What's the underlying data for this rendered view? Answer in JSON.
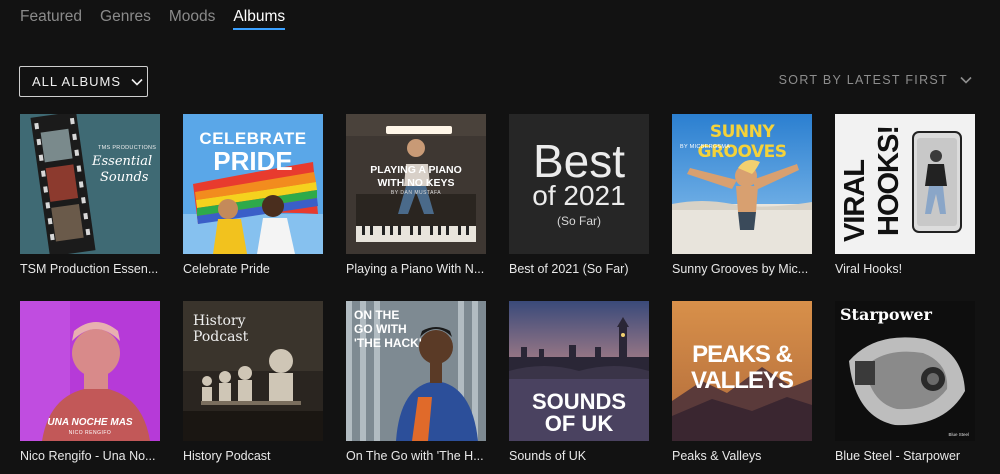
{
  "tabs": [
    {
      "label": "Featured",
      "active": false
    },
    {
      "label": "Genres",
      "active": false
    },
    {
      "label": "Moods",
      "active": false
    },
    {
      "label": "Albums",
      "active": true
    }
  ],
  "filter": {
    "label": "ALL ALBUMS"
  },
  "sort": {
    "label": "SORT BY LATEST FIRST"
  },
  "colors": {
    "background": "#121212",
    "active_tab_underline": "#3aa0ff"
  },
  "albums": [
    {
      "title": "TSM Production Essen...",
      "cover_text": [
        "TMS PRODUCTIONS",
        "Essential",
        "Sounds"
      ]
    },
    {
      "title": "Celebrate Pride",
      "cover_text": [
        "CELEBRATE",
        "PRIDE"
      ]
    },
    {
      "title": "Playing a Piano With N...",
      "cover_text": [
        "PLAYING A PIANO",
        "WITH NO KEYS",
        "BY DAN MUSTAFA"
      ]
    },
    {
      "title": "Best of 2021 (So Far)",
      "cover_text": [
        "Best",
        "of 2021",
        "(So Far)"
      ]
    },
    {
      "title": "Sunny Grooves by Mic...",
      "cover_text": [
        "SUNNY GROOVES",
        "BY MICBERGSMA"
      ]
    },
    {
      "title": "Viral Hooks!",
      "cover_text": [
        "VIRAL",
        "HOOKS!"
      ]
    },
    {
      "title": "Nico Rengifo - Una No...",
      "cover_text": [
        "UNA NOCHE MAS",
        "NICO RENGIFO"
      ]
    },
    {
      "title": "History Podcast",
      "cover_text": [
        "History",
        "Podcast"
      ]
    },
    {
      "title": "On The Go with 'The H...",
      "cover_text": [
        "ON THE",
        "GO WITH",
        "'THE HACK'"
      ]
    },
    {
      "title": "Sounds of UK",
      "cover_text": [
        "SOUNDS",
        "OF UK"
      ]
    },
    {
      "title": "Peaks & Valleys",
      "cover_text": [
        "PEAKS &",
        "VALLEYS"
      ]
    },
    {
      "title": "Blue Steel - Starpower",
      "cover_text": [
        "Starpower",
        "Blue Steel"
      ]
    }
  ]
}
